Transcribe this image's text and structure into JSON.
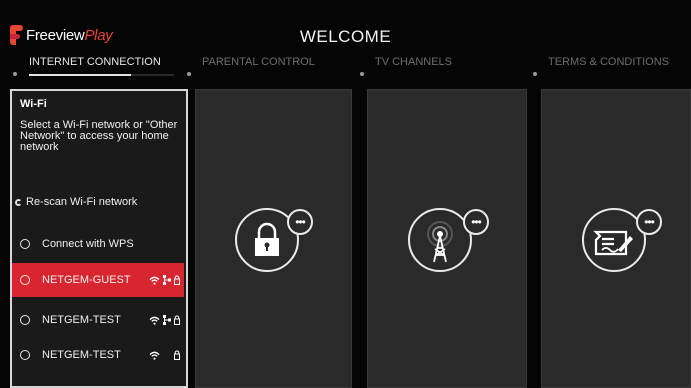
{
  "header": {
    "logo_text": "Freeview",
    "logo_play": "Play",
    "title": "WELCOME"
  },
  "steps": [
    {
      "label": "INTERNET CONNECTION",
      "active": true,
      "progress": 0.7
    },
    {
      "label": "PARENTAL CONTROL",
      "active": false
    },
    {
      "label": "TV CHANNELS",
      "active": false
    },
    {
      "label": "TERMS & CONDITIONS",
      "active": false
    }
  ],
  "wifi_panel": {
    "header": "Wi-Fi",
    "description": "Select a Wi-Fi network or \"Other Network\" to access your home network",
    "rescan_label": "Re-scan Wi-Fi network",
    "networks": [
      {
        "label": "Connect with WPS",
        "selected": false,
        "icons": []
      },
      {
        "label": "NETGEM-GUEST",
        "selected": true,
        "icons": [
          "wifi-icon",
          "network-icon",
          "lock-icon"
        ]
      },
      {
        "label": "NETGEM-TEST",
        "selected": false,
        "icons": [
          "wifi-icon",
          "network-icon",
          "lock-icon"
        ]
      },
      {
        "label": "NETGEM-TEST",
        "selected": false,
        "icons": [
          "wifi-icon",
          "lock-icon"
        ]
      }
    ]
  },
  "panels": [
    {
      "name": "parental-control",
      "icon": "padlock-icon",
      "badge": "•••"
    },
    {
      "name": "tv-channels",
      "icon": "antenna-tower-icon",
      "badge": "•••"
    },
    {
      "name": "terms-conditions",
      "icon": "document-sign-icon",
      "badge": "•••"
    }
  ],
  "colors": {
    "accent": "#d7262f",
    "brand": "#e8462f",
    "background": "#050505",
    "panel": "#2a2a2a"
  }
}
